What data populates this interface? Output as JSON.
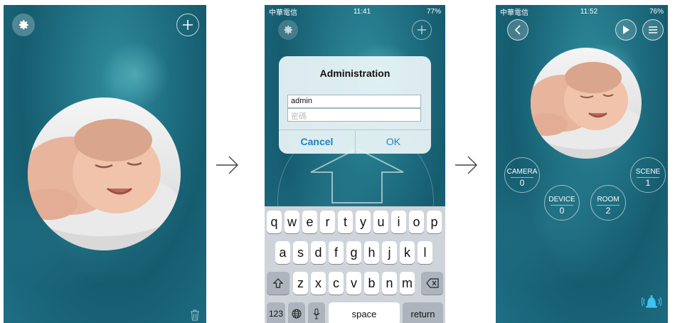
{
  "screen2": {
    "status": {
      "carrier": "中華電信",
      "time": "11:41",
      "battery": "77%"
    },
    "dialog": {
      "title": "Administration",
      "username_value": "admin",
      "password_placeholder": "密碼",
      "cancel_label": "Cancel",
      "ok_label": "OK"
    },
    "keyboard": {
      "row1": [
        "q",
        "w",
        "e",
        "r",
        "t",
        "y",
        "u",
        "i",
        "o",
        "p"
      ],
      "row2": [
        "a",
        "s",
        "d",
        "f",
        "g",
        "h",
        "j",
        "k",
        "l"
      ],
      "row3": [
        "z",
        "x",
        "c",
        "v",
        "b",
        "n",
        "m"
      ],
      "numbers_label": "123",
      "space_label": "space",
      "return_label": "return"
    }
  },
  "screen3": {
    "status": {
      "carrier": "中華電信",
      "time": "11:52",
      "battery": "76%"
    },
    "categories": [
      {
        "label": "CAMERA",
        "count": "0"
      },
      {
        "label": "SCENE",
        "count": "1"
      },
      {
        "label": "DEVICE",
        "count": "0"
      },
      {
        "label": "ROOM",
        "count": "2"
      }
    ]
  },
  "icons": {
    "settings": "gear-icon",
    "add": "plus-icon",
    "delete": "trash-icon",
    "back": "chevron-left-icon",
    "play": "play-icon",
    "menu": "menu-icon",
    "alarm": "alarm-bell-icon",
    "shift": "shift-icon",
    "backspace": "backspace-icon",
    "globe": "globe-icon",
    "mic": "microphone-icon"
  }
}
